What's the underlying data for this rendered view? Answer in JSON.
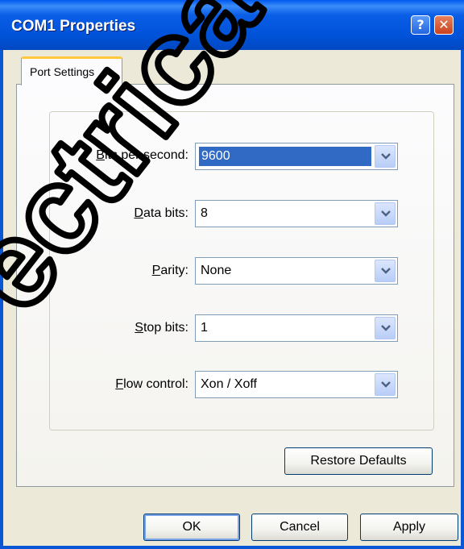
{
  "window": {
    "title": "COM1 Properties",
    "help_glyph": "?",
    "close_glyph": "✕"
  },
  "tabs": [
    {
      "label": "Port Settings",
      "active": true
    }
  ],
  "fields": {
    "bits_per_second": {
      "label": "Bits per second:",
      "value": "9600",
      "selected": true
    },
    "data_bits": {
      "label": "Data bits:",
      "value": "8"
    },
    "parity": {
      "label": "Parity:",
      "value": "None"
    },
    "stop_bits": {
      "label": "Stop bits:",
      "value": "1"
    },
    "flow_control": {
      "label": "Flow control:",
      "value": "Xon / Xoff"
    }
  },
  "buttons": {
    "restore_defaults": "Restore Defaults",
    "ok": "OK",
    "cancel": "Cancel",
    "apply": "Apply"
  },
  "watermark": {
    "text": "ectrica",
    "color": "#000000"
  },
  "colors": {
    "title_bar": "#0053d9",
    "selection": "#316ac5",
    "tab_highlight": "#ffc83d",
    "face": "#ece9d8"
  }
}
